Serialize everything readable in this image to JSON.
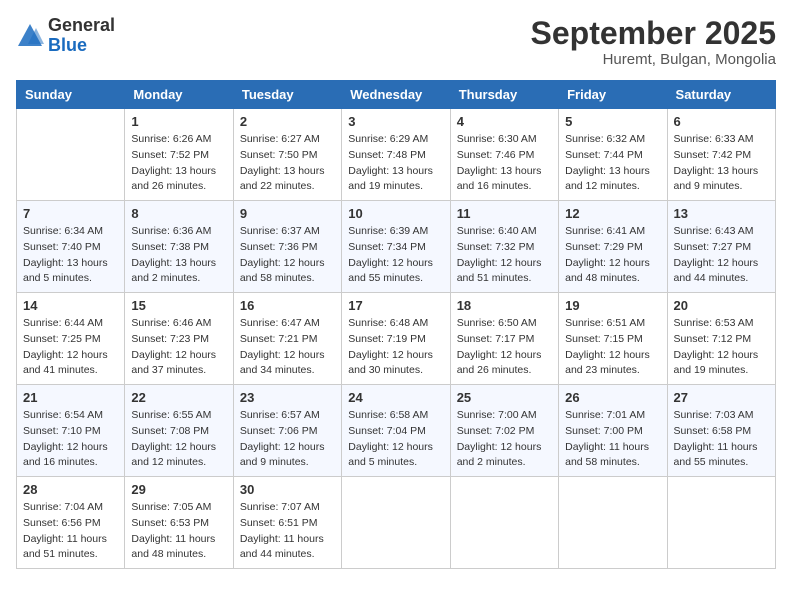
{
  "logo": {
    "general": "General",
    "blue": "Blue"
  },
  "header": {
    "month": "September 2025",
    "location": "Huremt, Bulgan, Mongolia"
  },
  "weekdays": [
    "Sunday",
    "Monday",
    "Tuesday",
    "Wednesday",
    "Thursday",
    "Friday",
    "Saturday"
  ],
  "weeks": [
    [
      {
        "day": "",
        "info": ""
      },
      {
        "day": "1",
        "info": "Sunrise: 6:26 AM\nSunset: 7:52 PM\nDaylight: 13 hours\nand 26 minutes."
      },
      {
        "day": "2",
        "info": "Sunrise: 6:27 AM\nSunset: 7:50 PM\nDaylight: 13 hours\nand 22 minutes."
      },
      {
        "day": "3",
        "info": "Sunrise: 6:29 AM\nSunset: 7:48 PM\nDaylight: 13 hours\nand 19 minutes."
      },
      {
        "day": "4",
        "info": "Sunrise: 6:30 AM\nSunset: 7:46 PM\nDaylight: 13 hours\nand 16 minutes."
      },
      {
        "day": "5",
        "info": "Sunrise: 6:32 AM\nSunset: 7:44 PM\nDaylight: 13 hours\nand 12 minutes."
      },
      {
        "day": "6",
        "info": "Sunrise: 6:33 AM\nSunset: 7:42 PM\nDaylight: 13 hours\nand 9 minutes."
      }
    ],
    [
      {
        "day": "7",
        "info": "Sunrise: 6:34 AM\nSunset: 7:40 PM\nDaylight: 13 hours\nand 5 minutes."
      },
      {
        "day": "8",
        "info": "Sunrise: 6:36 AM\nSunset: 7:38 PM\nDaylight: 13 hours\nand 2 minutes."
      },
      {
        "day": "9",
        "info": "Sunrise: 6:37 AM\nSunset: 7:36 PM\nDaylight: 12 hours\nand 58 minutes."
      },
      {
        "day": "10",
        "info": "Sunrise: 6:39 AM\nSunset: 7:34 PM\nDaylight: 12 hours\nand 55 minutes."
      },
      {
        "day": "11",
        "info": "Sunrise: 6:40 AM\nSunset: 7:32 PM\nDaylight: 12 hours\nand 51 minutes."
      },
      {
        "day": "12",
        "info": "Sunrise: 6:41 AM\nSunset: 7:29 PM\nDaylight: 12 hours\nand 48 minutes."
      },
      {
        "day": "13",
        "info": "Sunrise: 6:43 AM\nSunset: 7:27 PM\nDaylight: 12 hours\nand 44 minutes."
      }
    ],
    [
      {
        "day": "14",
        "info": "Sunrise: 6:44 AM\nSunset: 7:25 PM\nDaylight: 12 hours\nand 41 minutes."
      },
      {
        "day": "15",
        "info": "Sunrise: 6:46 AM\nSunset: 7:23 PM\nDaylight: 12 hours\nand 37 minutes."
      },
      {
        "day": "16",
        "info": "Sunrise: 6:47 AM\nSunset: 7:21 PM\nDaylight: 12 hours\nand 34 minutes."
      },
      {
        "day": "17",
        "info": "Sunrise: 6:48 AM\nSunset: 7:19 PM\nDaylight: 12 hours\nand 30 minutes."
      },
      {
        "day": "18",
        "info": "Sunrise: 6:50 AM\nSunset: 7:17 PM\nDaylight: 12 hours\nand 26 minutes."
      },
      {
        "day": "19",
        "info": "Sunrise: 6:51 AM\nSunset: 7:15 PM\nDaylight: 12 hours\nand 23 minutes."
      },
      {
        "day": "20",
        "info": "Sunrise: 6:53 AM\nSunset: 7:12 PM\nDaylight: 12 hours\nand 19 minutes."
      }
    ],
    [
      {
        "day": "21",
        "info": "Sunrise: 6:54 AM\nSunset: 7:10 PM\nDaylight: 12 hours\nand 16 minutes."
      },
      {
        "day": "22",
        "info": "Sunrise: 6:55 AM\nSunset: 7:08 PM\nDaylight: 12 hours\nand 12 minutes."
      },
      {
        "day": "23",
        "info": "Sunrise: 6:57 AM\nSunset: 7:06 PM\nDaylight: 12 hours\nand 9 minutes."
      },
      {
        "day": "24",
        "info": "Sunrise: 6:58 AM\nSunset: 7:04 PM\nDaylight: 12 hours\nand 5 minutes."
      },
      {
        "day": "25",
        "info": "Sunrise: 7:00 AM\nSunset: 7:02 PM\nDaylight: 12 hours\nand 2 minutes."
      },
      {
        "day": "26",
        "info": "Sunrise: 7:01 AM\nSunset: 7:00 PM\nDaylight: 11 hours\nand 58 minutes."
      },
      {
        "day": "27",
        "info": "Sunrise: 7:03 AM\nSunset: 6:58 PM\nDaylight: 11 hours\nand 55 minutes."
      }
    ],
    [
      {
        "day": "28",
        "info": "Sunrise: 7:04 AM\nSunset: 6:56 PM\nDaylight: 11 hours\nand 51 minutes."
      },
      {
        "day": "29",
        "info": "Sunrise: 7:05 AM\nSunset: 6:53 PM\nDaylight: 11 hours\nand 48 minutes."
      },
      {
        "day": "30",
        "info": "Sunrise: 7:07 AM\nSunset: 6:51 PM\nDaylight: 11 hours\nand 44 minutes."
      },
      {
        "day": "",
        "info": ""
      },
      {
        "day": "",
        "info": ""
      },
      {
        "day": "",
        "info": ""
      },
      {
        "day": "",
        "info": ""
      }
    ]
  ]
}
